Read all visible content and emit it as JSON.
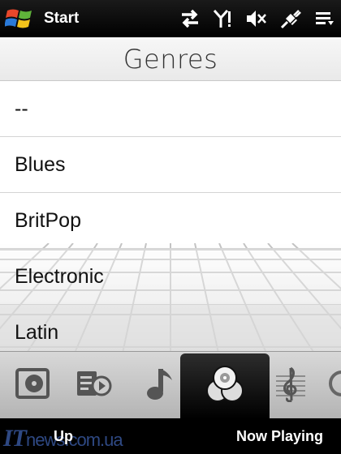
{
  "statusbar": {
    "start_label": "Start",
    "icons": [
      "windows-logo-icon",
      "data-sync-icon",
      "signal-icon",
      "volume-muted-icon",
      "charging-icon",
      "menu-icon"
    ]
  },
  "title": "Genres",
  "genres": [
    "--",
    "Blues",
    "BritPop",
    "Electronic",
    "Latin"
  ],
  "tabs": [
    {
      "name": "album-icon",
      "active": false
    },
    {
      "name": "playlist-icon",
      "active": false
    },
    {
      "name": "music-note-icon",
      "active": false
    },
    {
      "name": "genre-discs-icon",
      "active": true
    },
    {
      "name": "treble-clef-icon",
      "active": false
    }
  ],
  "softkeys": {
    "left": "Up",
    "right": "Now Playing"
  },
  "watermark": {
    "it": "IT",
    "site": "news.com.ua"
  },
  "colors": {
    "statusbar_bg": "#000000",
    "active_tab": "#1a1a1a",
    "watermark": "#466ec8"
  }
}
